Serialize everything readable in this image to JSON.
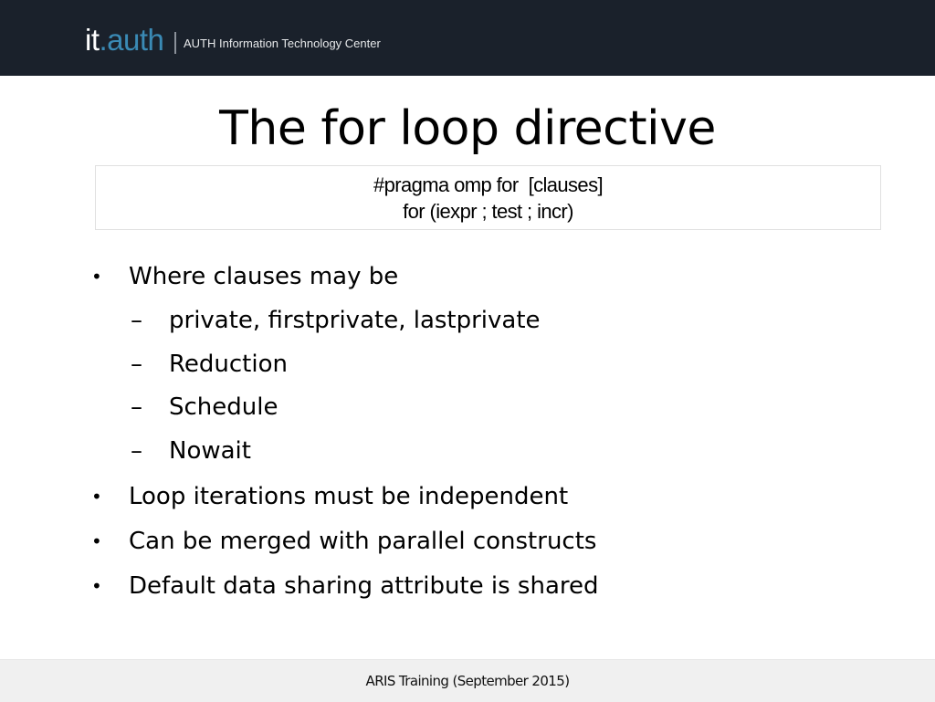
{
  "header": {
    "logo_it": "it",
    "logo_auth": ".auth",
    "organization": "AUTH Information Technology Center",
    "colors": {
      "background": "#1a212b",
      "logo_accent": "#3a8ab5"
    }
  },
  "slide": {
    "title": "The for loop directive",
    "code": [
      "#pragma omp for  [clauses]",
      "for (iexpr ; test ; incr)"
    ],
    "bullets": [
      {
        "text": "Where clauses may be",
        "level": 1,
        "marker": "•"
      },
      {
        "text": "private, firstprivate, lastprivate",
        "level": 2,
        "marker": "–"
      },
      {
        "text": "Reduction",
        "level": 2,
        "marker": "–"
      },
      {
        "text": "Schedule",
        "level": 2,
        "marker": "–"
      },
      {
        "text": "Nowait",
        "level": 2,
        "marker": "–"
      },
      {
        "text": "Loop iterations must be independent",
        "level": 1,
        "marker": "•"
      },
      {
        "text": "Can be merged with parallel constructs",
        "level": 1,
        "marker": "•"
      },
      {
        "text": "Default data sharing attribute is shared",
        "level": 1,
        "marker": "•"
      }
    ]
  },
  "footer": {
    "text": "ARIS Training (September 2015)"
  }
}
